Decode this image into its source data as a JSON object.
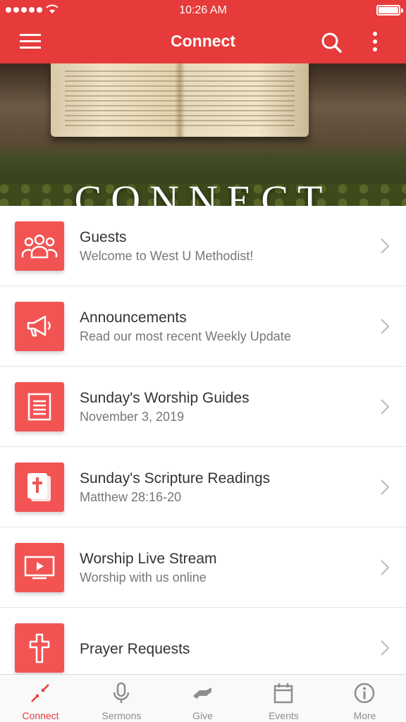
{
  "colors": {
    "accent": "#e63b3a",
    "tile": "#f25454"
  },
  "status_bar": {
    "time": "10:26 AM"
  },
  "nav": {
    "title": "Connect",
    "icons": [
      "menu-icon",
      "search-icon",
      "more-vertical-icon"
    ]
  },
  "hero": {
    "title": "CONNECT"
  },
  "list": [
    {
      "icon": "group-icon",
      "title": "Guests",
      "subtitle": "Welcome to West U Methodist!"
    },
    {
      "icon": "megaphone-icon",
      "title": "Announcements",
      "subtitle": "Read our most recent Weekly Update"
    },
    {
      "icon": "document-icon",
      "title": "Sunday's Worship Guides",
      "subtitle": "November 3, 2019"
    },
    {
      "icon": "bible-icon",
      "title": "Sunday's Scripture Readings",
      "subtitle": "Matthew 28:16-20"
    },
    {
      "icon": "tv-play-icon",
      "title": "Worship Live Stream",
      "subtitle": "Worship with us online"
    },
    {
      "icon": "cross-icon",
      "title": "Prayer Requests",
      "subtitle": ""
    }
  ],
  "tabs": [
    {
      "icon": "connect-arrows-icon",
      "label": "Connect",
      "active": true
    },
    {
      "icon": "microphone-icon",
      "label": "Sermons"
    },
    {
      "icon": "give-hand-icon",
      "label": "Give"
    },
    {
      "icon": "calendar-icon",
      "label": "Events"
    },
    {
      "icon": "info-icon",
      "label": "More"
    }
  ]
}
